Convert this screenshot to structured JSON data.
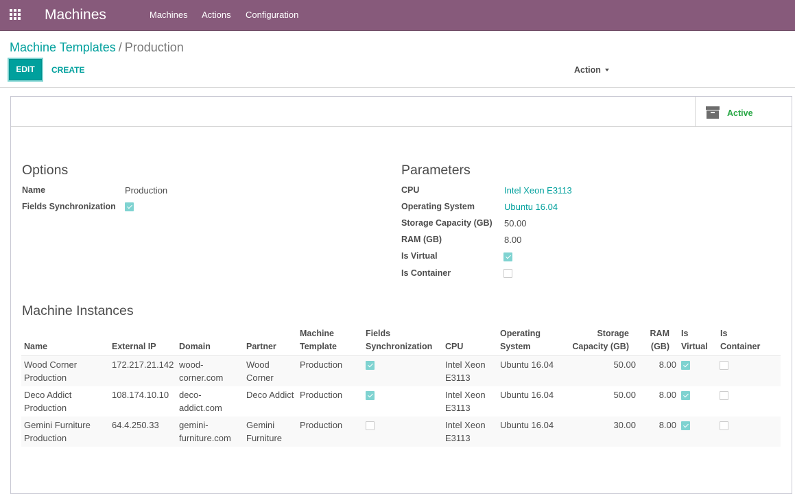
{
  "navbar": {
    "brand": "Machines",
    "menu": [
      "Machines",
      "Actions",
      "Configuration"
    ]
  },
  "breadcrumb": {
    "parent": "Machine Templates",
    "separator": "/",
    "current": "Production"
  },
  "buttons": {
    "edit": "EDIT",
    "create": "CREATE",
    "action": "Action"
  },
  "status": {
    "active_label": "Active",
    "active_color": "#28a745"
  },
  "options": {
    "title": "Options",
    "name_label": "Name",
    "name_value": "Production",
    "sync_label": "Fields Synchronization",
    "sync_checked": true
  },
  "parameters": {
    "title": "Parameters",
    "cpu_label": "CPU",
    "cpu_value": "Intel Xeon E3113",
    "os_label": "Operating System",
    "os_value": "Ubuntu 16.04",
    "storage_label": "Storage Capacity (GB)",
    "storage_value": "50.00",
    "ram_label": "RAM (GB)",
    "ram_value": "8.00",
    "virtual_label": "Is Virtual",
    "virtual_checked": true,
    "container_label": "Is Container",
    "container_checked": false
  },
  "instances": {
    "title": "Machine Instances",
    "headers": {
      "name": "Name",
      "ip": "External IP",
      "domain": "Domain",
      "partner": "Partner",
      "template_1": "Machine",
      "template_2": "Template",
      "sync_1": "Fields",
      "sync_2": "Synchronization",
      "cpu": "CPU",
      "os_1": "Operating",
      "os_2": "System",
      "storage_1": "Storage",
      "storage_2": "Capacity (GB)",
      "ram_1": "RAM",
      "ram_2": "(GB)",
      "virtual_1": "Is",
      "virtual_2": "Virtual",
      "container_1": "Is",
      "container_2": "Container"
    },
    "rows": [
      {
        "name_1": "Wood Corner",
        "name_2": "Production",
        "ip": "172.217.21.142",
        "domain_1": "wood-",
        "domain_2": "corner.com",
        "partner_1": "Wood",
        "partner_2": "Corner",
        "template": "Production",
        "sync": true,
        "cpu_1": "Intel Xeon",
        "cpu_2": "E3113",
        "os": "Ubuntu 16.04",
        "storage": "50.00",
        "ram": "8.00",
        "virtual": true,
        "container": false
      },
      {
        "name_1": "Deco Addict",
        "name_2": "Production",
        "ip": "108.174.10.10",
        "domain_1": "deco-",
        "domain_2": "addict.com",
        "partner_1": "Deco Addict",
        "partner_2": "",
        "template": "Production",
        "sync": true,
        "cpu_1": "Intel Xeon",
        "cpu_2": "E3113",
        "os": "Ubuntu 16.04",
        "storage": "50.00",
        "ram": "8.00",
        "virtual": true,
        "container": false
      },
      {
        "name_1": "Gemini Furniture",
        "name_2": "Production",
        "ip": "64.4.250.33",
        "domain_1": "gemini-",
        "domain_2": "furniture.com",
        "partner_1": "Gemini",
        "partner_2": "Furniture",
        "template": "Production",
        "sync": false,
        "cpu_1": "Intel Xeon",
        "cpu_2": "E3113",
        "os": "Ubuntu 16.04",
        "storage": "30.00",
        "ram": "8.00",
        "virtual": true,
        "container": false
      }
    ]
  },
  "colors": {
    "brand": "#875a7b",
    "accent": "#00a09d",
    "checkbox_on": "#7fd3d1"
  }
}
